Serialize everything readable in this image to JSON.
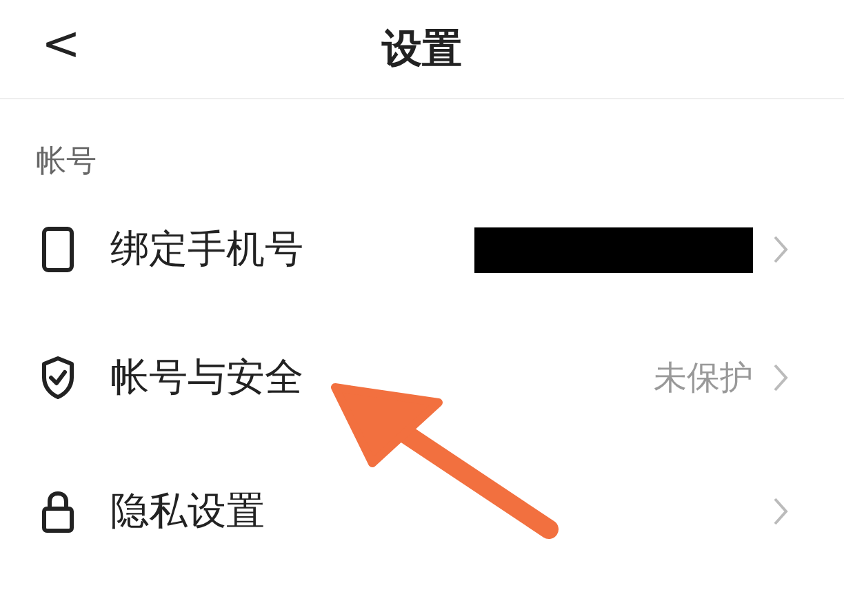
{
  "header": {
    "back": "<",
    "title": "设置"
  },
  "section": {
    "title": "帐号"
  },
  "rows": [
    {
      "label": "绑定手机号",
      "redacted": true
    },
    {
      "label": "帐号与安全",
      "value": "未保护"
    },
    {
      "label": "隐私设置"
    }
  ]
}
